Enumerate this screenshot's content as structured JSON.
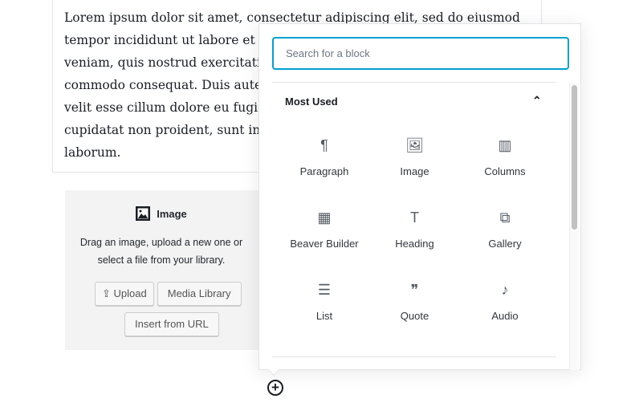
{
  "paragraph": {
    "lines": [
      "Lorem ipsum dolor sit amet, consectetur adipiscing elit, sed do eiusmod",
      "tempor incididunt ut labore et d",
      "veniam, quis nostrud exercitatio",
      "commodo consequat. Duis aute",
      "velit esse cillum dolore eu fugiat",
      "cupidatat non proident, sunt in",
      "laborum."
    ]
  },
  "image_block": {
    "icon": "image-icon",
    "title": "Image",
    "instructions_line1": "Drag an image, upload a new one or",
    "instructions_line2": "select a file from your library.",
    "upload_label": "Upload",
    "media_library_label": "Media Library",
    "insert_url_label": "Insert from URL"
  },
  "inserter": {
    "search_placeholder": "Search for a block",
    "section_title": "Most Used",
    "accent": "#00a0d2",
    "blocks": [
      {
        "label": "Paragraph",
        "icon": "¶"
      },
      {
        "label": "Image",
        "icon": "🖼"
      },
      {
        "label": "Columns",
        "icon": "▥"
      },
      {
        "label": "Beaver Builder",
        "icon": "▦"
      },
      {
        "label": "Heading",
        "icon": "T"
      },
      {
        "label": "Gallery",
        "icon": "⧉"
      },
      {
        "label": "List",
        "icon": "☰"
      },
      {
        "label": "Quote",
        "icon": "❞"
      },
      {
        "label": "Audio",
        "icon": "♪"
      }
    ]
  },
  "add_block": {
    "icon": "+"
  }
}
